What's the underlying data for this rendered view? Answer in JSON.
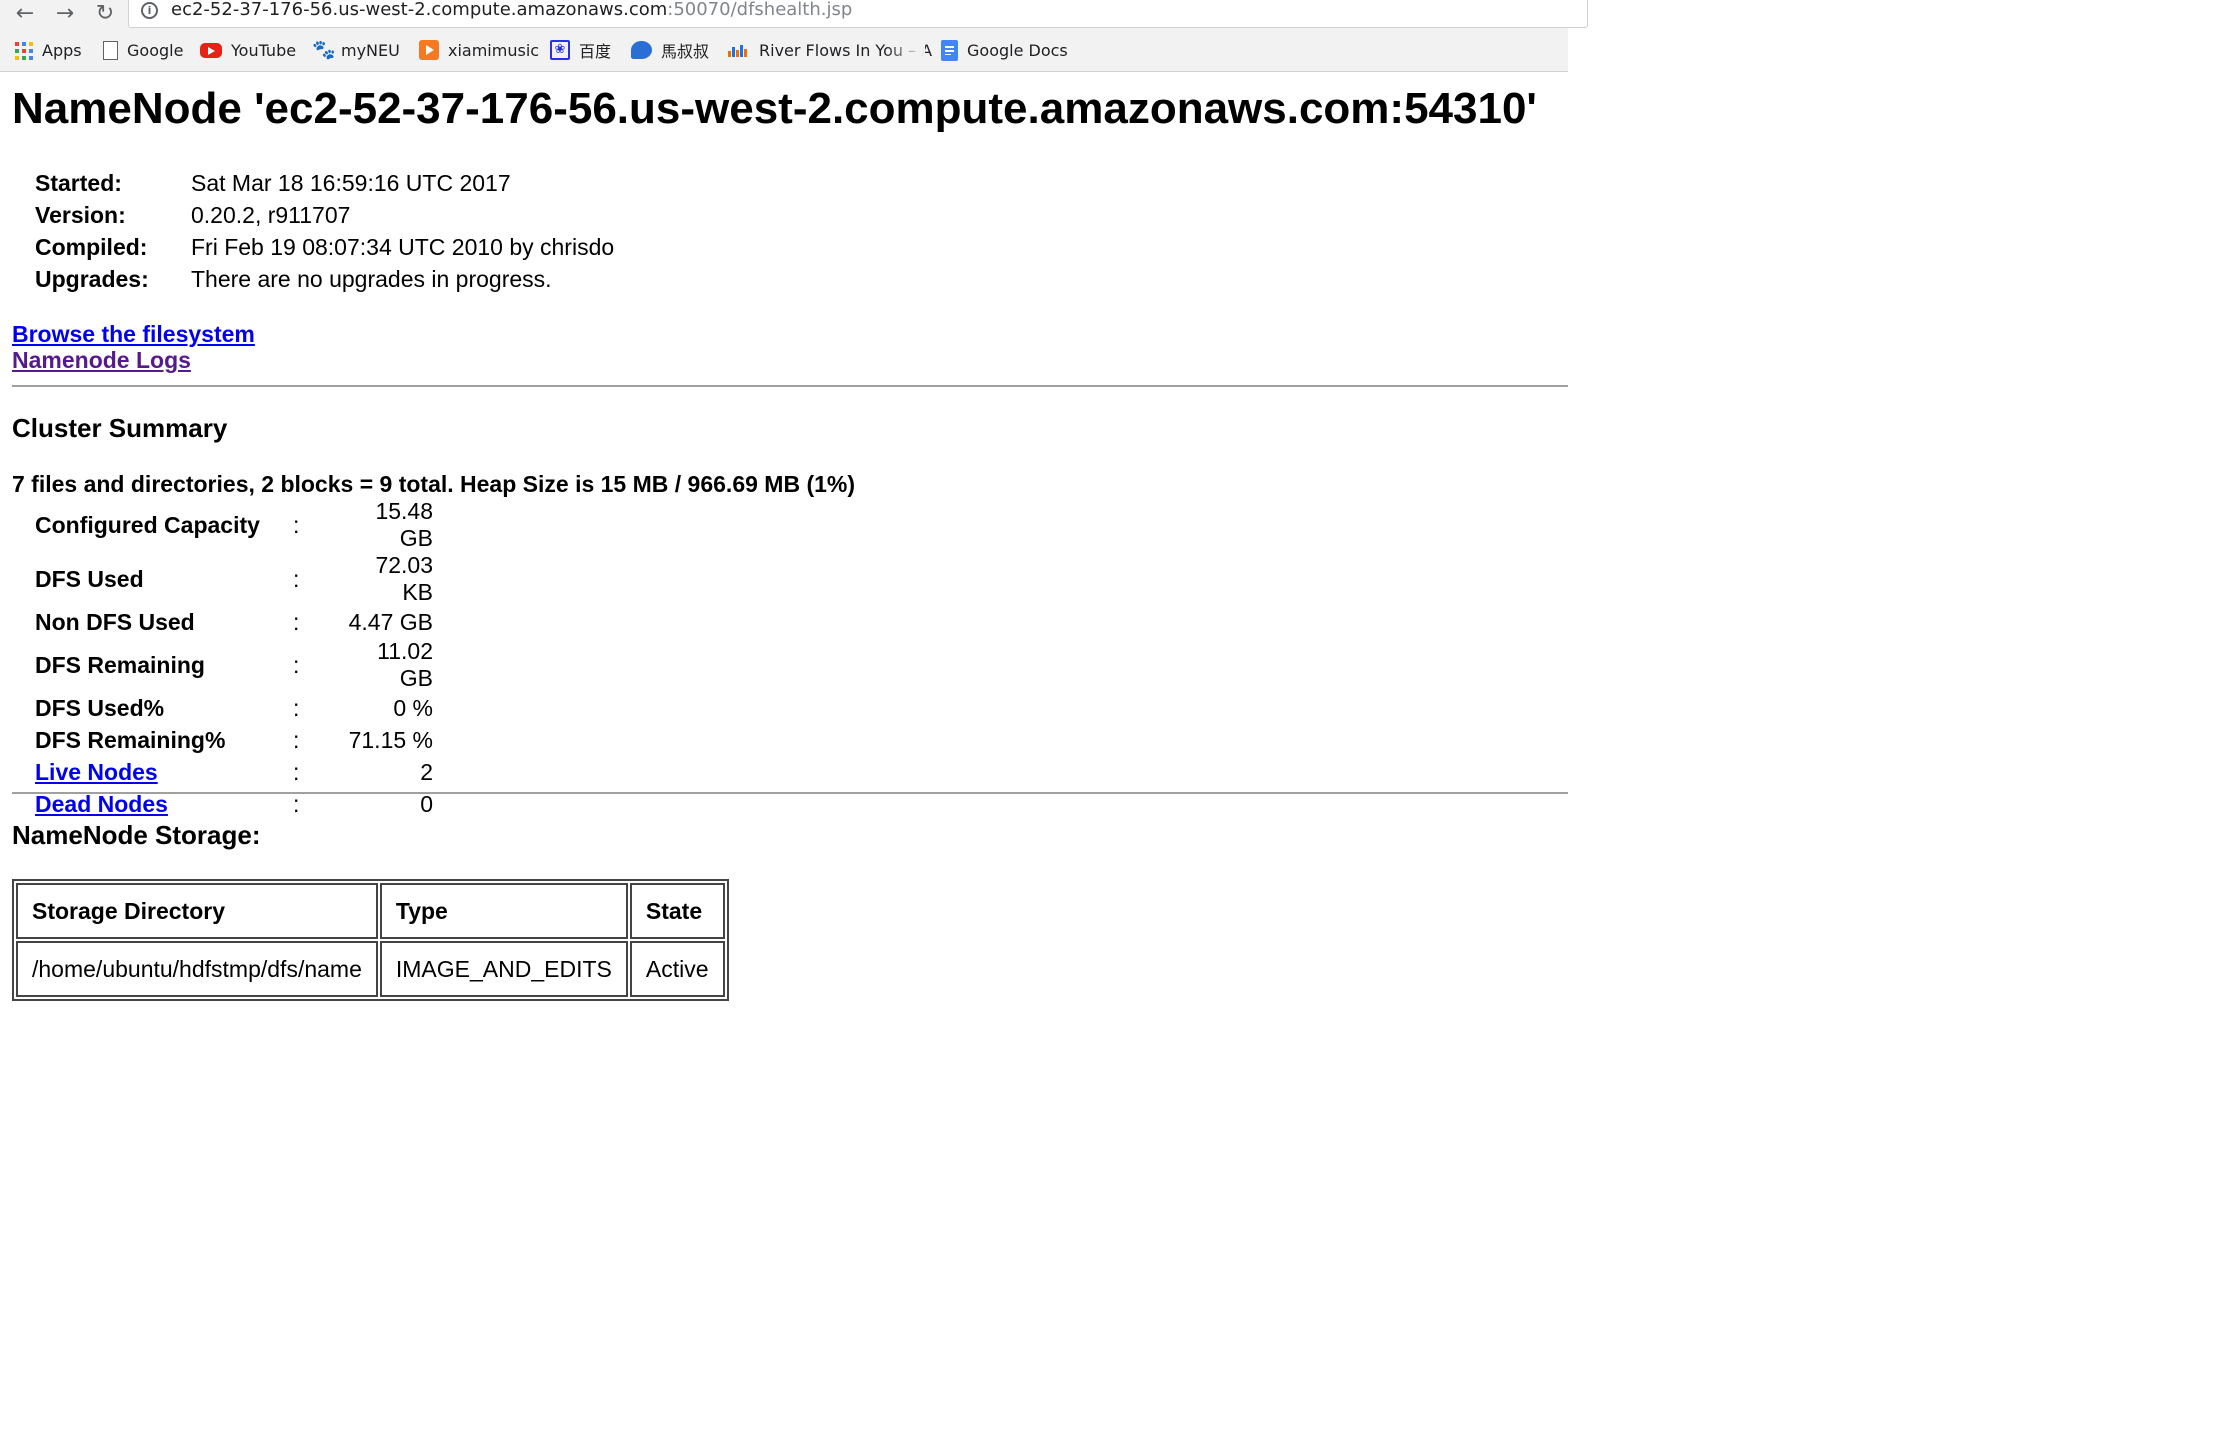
{
  "browser": {
    "url_host": "ec2-52-37-176-56.us-west-2.compute.amazonaws.com",
    "url_path": ":50070/dfshealth.jsp",
    "bookmarks": [
      {
        "label": "Apps",
        "icon": "apps-grid-icon"
      },
      {
        "label": "Google",
        "icon": "page-icon"
      },
      {
        "label": "YouTube",
        "icon": "youtube-icon"
      },
      {
        "label": "myNEU",
        "icon": "paw-icon"
      },
      {
        "label": "xiamimusic",
        "icon": "xiami-icon"
      },
      {
        "label": "百度",
        "icon": "baidu-icon"
      },
      {
        "label": "馬叔叔",
        "icon": "chat-bubble-icon"
      },
      {
        "label": "River Flows In You – A",
        "icon": "audio-bars-icon"
      },
      {
        "label": "Google Docs",
        "icon": "google-docs-icon"
      }
    ]
  },
  "page": {
    "title": "NameNode 'ec2-52-37-176-56.us-west-2.compute.amazonaws.com:54310'",
    "info": [
      {
        "key": "Started:",
        "value": "Sat Mar 18 16:59:16 UTC 2017"
      },
      {
        "key": "Version:",
        "value": "0.20.2, r911707"
      },
      {
        "key": "Compiled:",
        "value": "Fri Feb 19 08:07:34 UTC 2010 by chrisdo"
      },
      {
        "key": "Upgrades:",
        "value": "There are no upgrades in progress."
      }
    ],
    "links": {
      "browse": "Browse the filesystem",
      "logs": "Namenode Logs"
    }
  },
  "cluster_summary": {
    "heading": "Cluster Summary",
    "summary_line": "7 files and directories, 2 blocks = 9 total. Heap Size is 15 MB / 966.69 MB (1%)",
    "colon": ":",
    "stats": [
      {
        "label": "Configured Capacity",
        "value": "15.48 GB"
      },
      {
        "label": "DFS Used",
        "value": "72.03 KB"
      },
      {
        "label": "Non DFS Used",
        "value": "4.47 GB"
      },
      {
        "label": "DFS Remaining",
        "value": "11.02 GB"
      },
      {
        "label": "DFS Used%",
        "value": "0 %"
      },
      {
        "label": "DFS Remaining%",
        "value": "71.15 %"
      },
      {
        "label": "Live Nodes",
        "value": "2"
      },
      {
        "label": "Dead Nodes",
        "value": "0"
      }
    ]
  },
  "storage": {
    "heading": "NameNode Storage:",
    "columns": [
      "Storage Directory",
      "Type",
      "State"
    ],
    "rows": [
      [
        "/home/ubuntu/hdfstmp/dfs/name",
        "IMAGE_AND_EDITS",
        "Active"
      ]
    ]
  },
  "colors": {
    "link": "#0000ee",
    "visited_link": "#551a8b",
    "youtube_red": "#e62117",
    "xiami_orange": "#f47920",
    "google_docs_blue": "#4285f4"
  }
}
